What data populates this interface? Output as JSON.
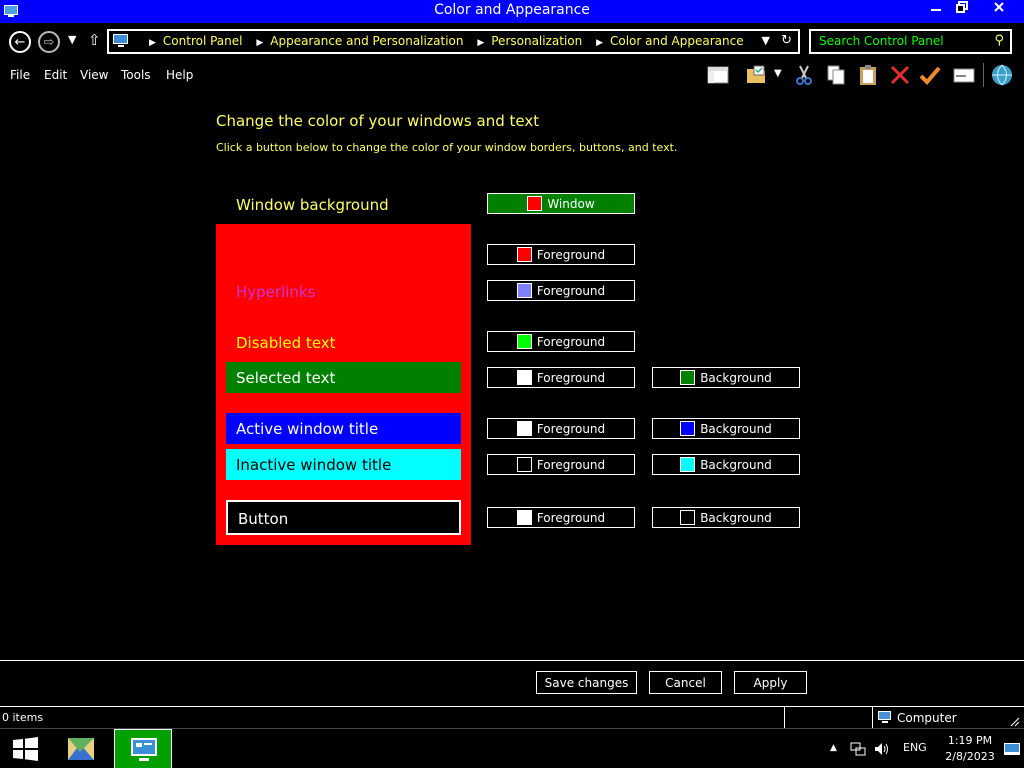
{
  "window": {
    "title": "Color and Appearance"
  },
  "nav": {
    "breadcrumbs": [
      "Control Panel",
      "Appearance and Personalization",
      "Personalization",
      "Color and Appearance"
    ],
    "search_placeholder": "Search Control Panel"
  },
  "menu": [
    "File",
    "Edit",
    "View",
    "Tools",
    "Help"
  ],
  "content": {
    "heading": "Change the color of your windows and text",
    "subheading": "Click a button below to change the color of your window borders, buttons, and text."
  },
  "preview": {
    "window_background": "Window background",
    "hyperlinks": "Hyperlinks",
    "disabled_text": "Disabled text",
    "selected_text": "Selected text",
    "active_title": "Active window title",
    "inactive_title": "Inactive window title",
    "button": "Button"
  },
  "color_buttons": {
    "window": {
      "label": "Window",
      "color": "#ff0000"
    },
    "window_text_fg": {
      "label": "Foreground",
      "color": "#ff0000"
    },
    "hyperlinks_fg": {
      "label": "Foreground",
      "color": "#8080ff"
    },
    "disabled_fg": {
      "label": "Foreground",
      "color": "#00ff00"
    },
    "selected_fg": {
      "label": "Foreground",
      "color": "#ffffff"
    },
    "selected_bg": {
      "label": "Background",
      "color": "#008000"
    },
    "active_fg": {
      "label": "Foreground",
      "color": "#ffffff"
    },
    "active_bg": {
      "label": "Background",
      "color": "#0000ff"
    },
    "inactive_fg": {
      "label": "Foreground",
      "color": "#000000"
    },
    "inactive_bg": {
      "label": "Background",
      "color": "#00ffff"
    },
    "button_fg": {
      "label": "Foreground",
      "color": "#ffffff"
    },
    "button_bg": {
      "label": "Background",
      "color": "#000000"
    }
  },
  "footer": {
    "save": "Save changes",
    "cancel": "Cancel",
    "apply": "Apply"
  },
  "status": {
    "items": "0 items",
    "location": "Computer"
  },
  "taskbar": {
    "language": "ENG",
    "time": "1:19 PM",
    "date": "2/8/2023"
  },
  "theme_colors": {
    "titlebar": "#0000ff",
    "text_highlight": "#ffff66",
    "search_text": "#00ff00",
    "hyperlink": "#cc33cc",
    "disabled": "#ffff00",
    "window_bg": "#ff0000",
    "selected_bg": "#008000",
    "active_bg": "#0000ff",
    "inactive_bg": "#00ffff"
  }
}
